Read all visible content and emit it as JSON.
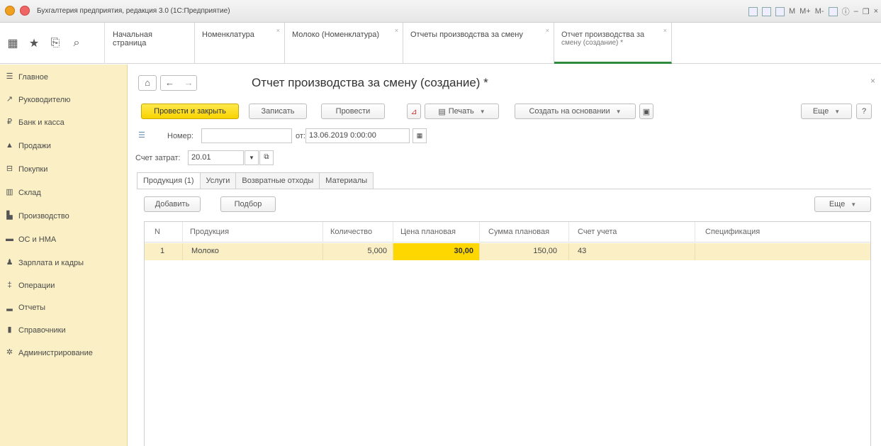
{
  "window": {
    "app_title": "Бухгалтерия предприятия, редакция 3.0 (1С:Предприятие)",
    "toolbar_right": [
      "M",
      "M+",
      "M-"
    ]
  },
  "quick_icons": [
    "apps-grid-icon",
    "star-icon",
    "history-icon",
    "search-icon"
  ],
  "tabs": [
    {
      "label": "Начальная страница"
    },
    {
      "label": "Номенклатура"
    },
    {
      "label": "Молоко (Номенклатура)"
    },
    {
      "label": "Отчеты производства за смену"
    },
    {
      "label_line1": "Отчет производства за",
      "label_line2": "смену (создание) *"
    }
  ],
  "sidebar": {
    "items": [
      {
        "label": "Главное",
        "icon": "menu-icon"
      },
      {
        "label": "Руководителю",
        "icon": "trend-icon"
      },
      {
        "label": "Банк и касса",
        "icon": "ruble-icon"
      },
      {
        "label": "Продажи",
        "icon": "sales-icon"
      },
      {
        "label": "Покупки",
        "icon": "cart-icon"
      },
      {
        "label": "Склад",
        "icon": "warehouse-icon"
      },
      {
        "label": "Производство",
        "icon": "factory-icon"
      },
      {
        "label": "ОС и НМА",
        "icon": "truck-icon"
      },
      {
        "label": "Зарплата и кадры",
        "icon": "person-icon"
      },
      {
        "label": "Операции",
        "icon": "operations-icon"
      },
      {
        "label": "Отчеты",
        "icon": "bar-chart-icon"
      },
      {
        "label": "Справочники",
        "icon": "book-icon"
      },
      {
        "label": "Администрирование",
        "icon": "gear-icon"
      }
    ]
  },
  "form": {
    "title": "Отчет производства за смену (создание) *",
    "nav": {
      "home": "⌂",
      "back": "←",
      "forward": "→"
    },
    "close": "×",
    "buttons": {
      "post_close": "Провести и закрыть",
      "save": "Записать",
      "post": "Провести",
      "print": "Печать",
      "create_based": "Создать на основании",
      "more": "Еще",
      "help": "?"
    },
    "number_label": "Номер:",
    "number_value": "",
    "date_label": "от:",
    "date_value": "13.06.2019  0:00:00",
    "account_label": "Счет затрат:",
    "account_value": "20.01",
    "inner_tabs": [
      "Продукция (1)",
      "Услуги",
      "Возвратные отходы",
      "Материалы"
    ],
    "table_buttons": {
      "add": "Добавить",
      "pick": "Подбор",
      "more": "Еще"
    },
    "table": {
      "columns": [
        "N",
        "Продукция",
        "Количество",
        "Цена плановая",
        "Сумма плановая",
        "Счет учета",
        "Спецификация"
      ],
      "rows": [
        {
          "n": "1",
          "product": "Молоко",
          "qty": "5,000",
          "price": "30,00",
          "sum": "150,00",
          "account": "43",
          "spec": ""
        }
      ]
    }
  },
  "colors": {
    "accent_green": "#2e8b3d",
    "primary_yellow": "#f7d300",
    "sidebar_bg": "#fbf0c5"
  }
}
